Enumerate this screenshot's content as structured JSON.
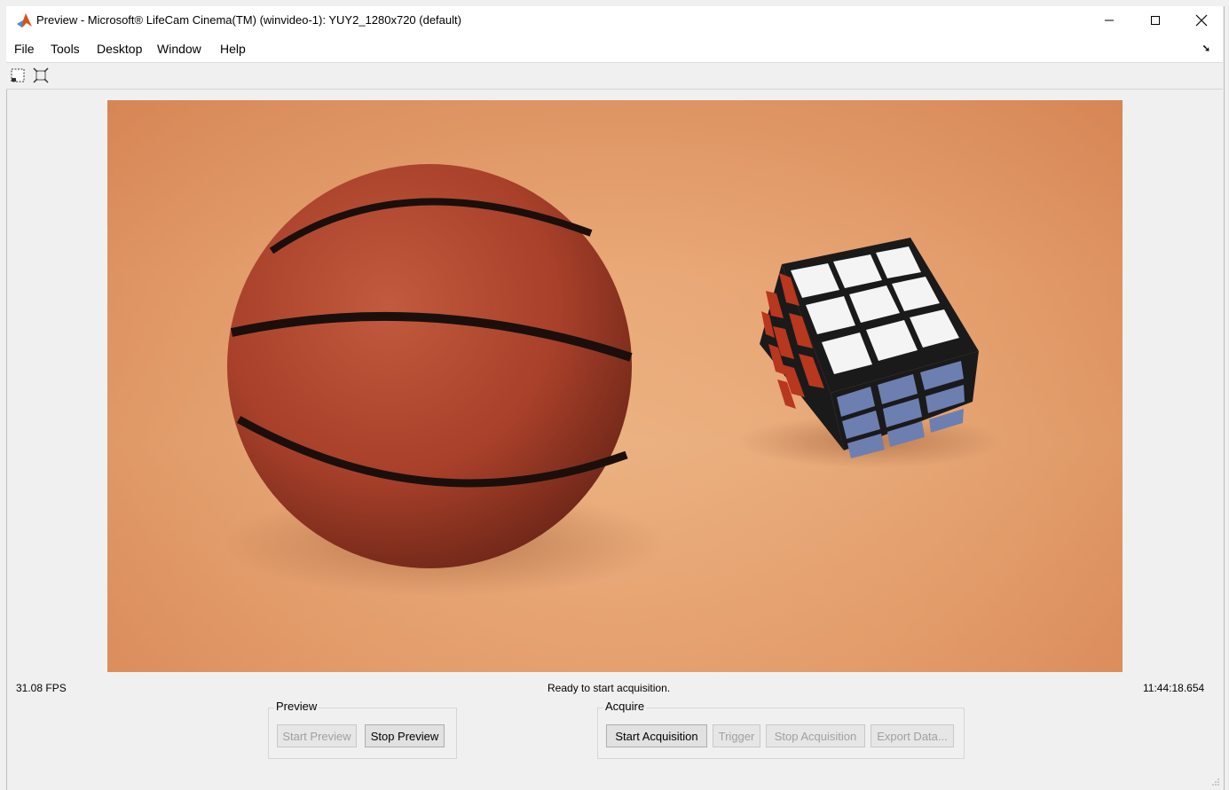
{
  "window": {
    "title": "Preview - Microsoft® LifeCam Cinema(TM) (winvideo-1): YUY2_1280x720 (default)",
    "controls": {
      "minimize": "—",
      "maximize": "☐",
      "close": "✕"
    }
  },
  "menu": {
    "items": [
      "File",
      "Tools",
      "Desktop",
      "Window",
      "Help"
    ],
    "dock_icon": "➘"
  },
  "toolbar": {
    "icons": [
      "zoom-region-icon",
      "fit-to-window-icon"
    ]
  },
  "status": {
    "fps": "31.08 FPS",
    "message": "Ready to start acquisition.",
    "timestamp": "11:44:18.654"
  },
  "preview_group": {
    "label": "Preview",
    "start_label": "Start Preview",
    "stop_label": "Stop Preview"
  },
  "acquire_group": {
    "label": "Acquire",
    "start_label": "Start Acquisition",
    "trigger_label": "Trigger",
    "stop_label": "Stop Acquisition",
    "export_label": "Export Data..."
  },
  "colors": {
    "accent": "#d95319",
    "video_bg": "#e8a573",
    "ball": "#a8402a",
    "cube_white": "#f4f4f4",
    "cube_red": "#b8371f",
    "cube_blue": "#6d7fb0"
  }
}
